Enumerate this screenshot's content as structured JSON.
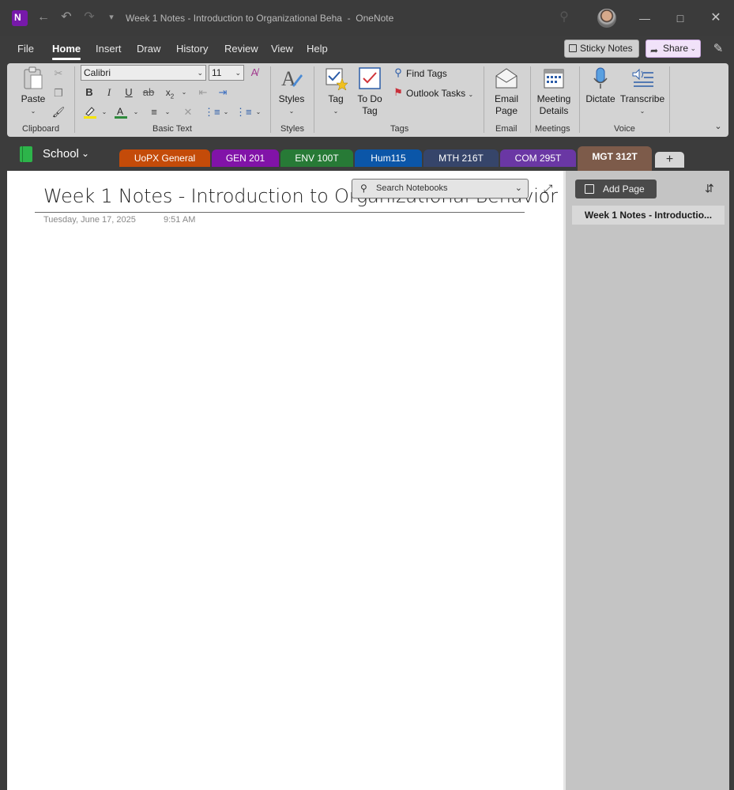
{
  "titlebar": {
    "title": "Week 1 Notes - Introduction to Organizational Beha",
    "app_name": "OneNote",
    "icons": [
      "onenote-logo",
      "back-icon",
      "undo-icon",
      "redo-icon",
      "customize-quick-access-icon",
      "search-icon",
      "minimize-icon",
      "maximize-icon",
      "close-icon"
    ]
  },
  "menu": {
    "items": [
      "File",
      "Home",
      "Insert",
      "Draw",
      "History",
      "Review",
      "View",
      "Help"
    ],
    "active": "Home",
    "sticky_notes": "Sticky Notes",
    "share": "Share"
  },
  "ribbon": {
    "clipboard": {
      "paste": "Paste",
      "label": "Clipboard"
    },
    "basic_text": {
      "font": "Calibri",
      "size": "11",
      "label": "Basic Text",
      "highlight_color": "#f5e400",
      "font_color": "#2e8b3c"
    },
    "styles": {
      "button": "Styles",
      "label": "Styles"
    },
    "tags": {
      "tag": "Tag",
      "todo_line1": "To Do",
      "todo_line2": "Tag",
      "find_tags": "Find Tags",
      "outlook_tasks": "Outlook Tasks",
      "label": "Tags"
    },
    "email": {
      "line1": "Email",
      "line2": "Page",
      "label": "Email"
    },
    "meetings": {
      "line1": "Meeting",
      "line2": "Details",
      "label": "Meetings"
    },
    "voice": {
      "dictate": "Dictate",
      "transcribe": "Transcribe",
      "label": "Voice"
    }
  },
  "notebook": {
    "name": "School",
    "sections": [
      {
        "name": "UoPX General",
        "color": "#c44b09"
      },
      {
        "name": "GEN 201",
        "color": "#8113a8"
      },
      {
        "name": "ENV 100T",
        "color": "#277a36"
      },
      {
        "name": "Hum115",
        "color": "#0b56a8"
      },
      {
        "name": "MTH 216T",
        "color": "#36456a"
      },
      {
        "name": "COM 295T",
        "color": "#6a37a4"
      },
      {
        "name": "MGT 312T",
        "color": "#7d5b4a"
      }
    ],
    "active_section": "MGT 312T"
  },
  "page": {
    "title": "Week 1 Notes - Introduction to Organizational Behavior",
    "date": "Tuesday, June 17, 2025",
    "time": "9:51 AM",
    "search_placeholder": "Search Notebooks"
  },
  "pages_pane": {
    "add_page": "Add Page",
    "items": [
      "Week 1 Notes - Introductio..."
    ]
  }
}
